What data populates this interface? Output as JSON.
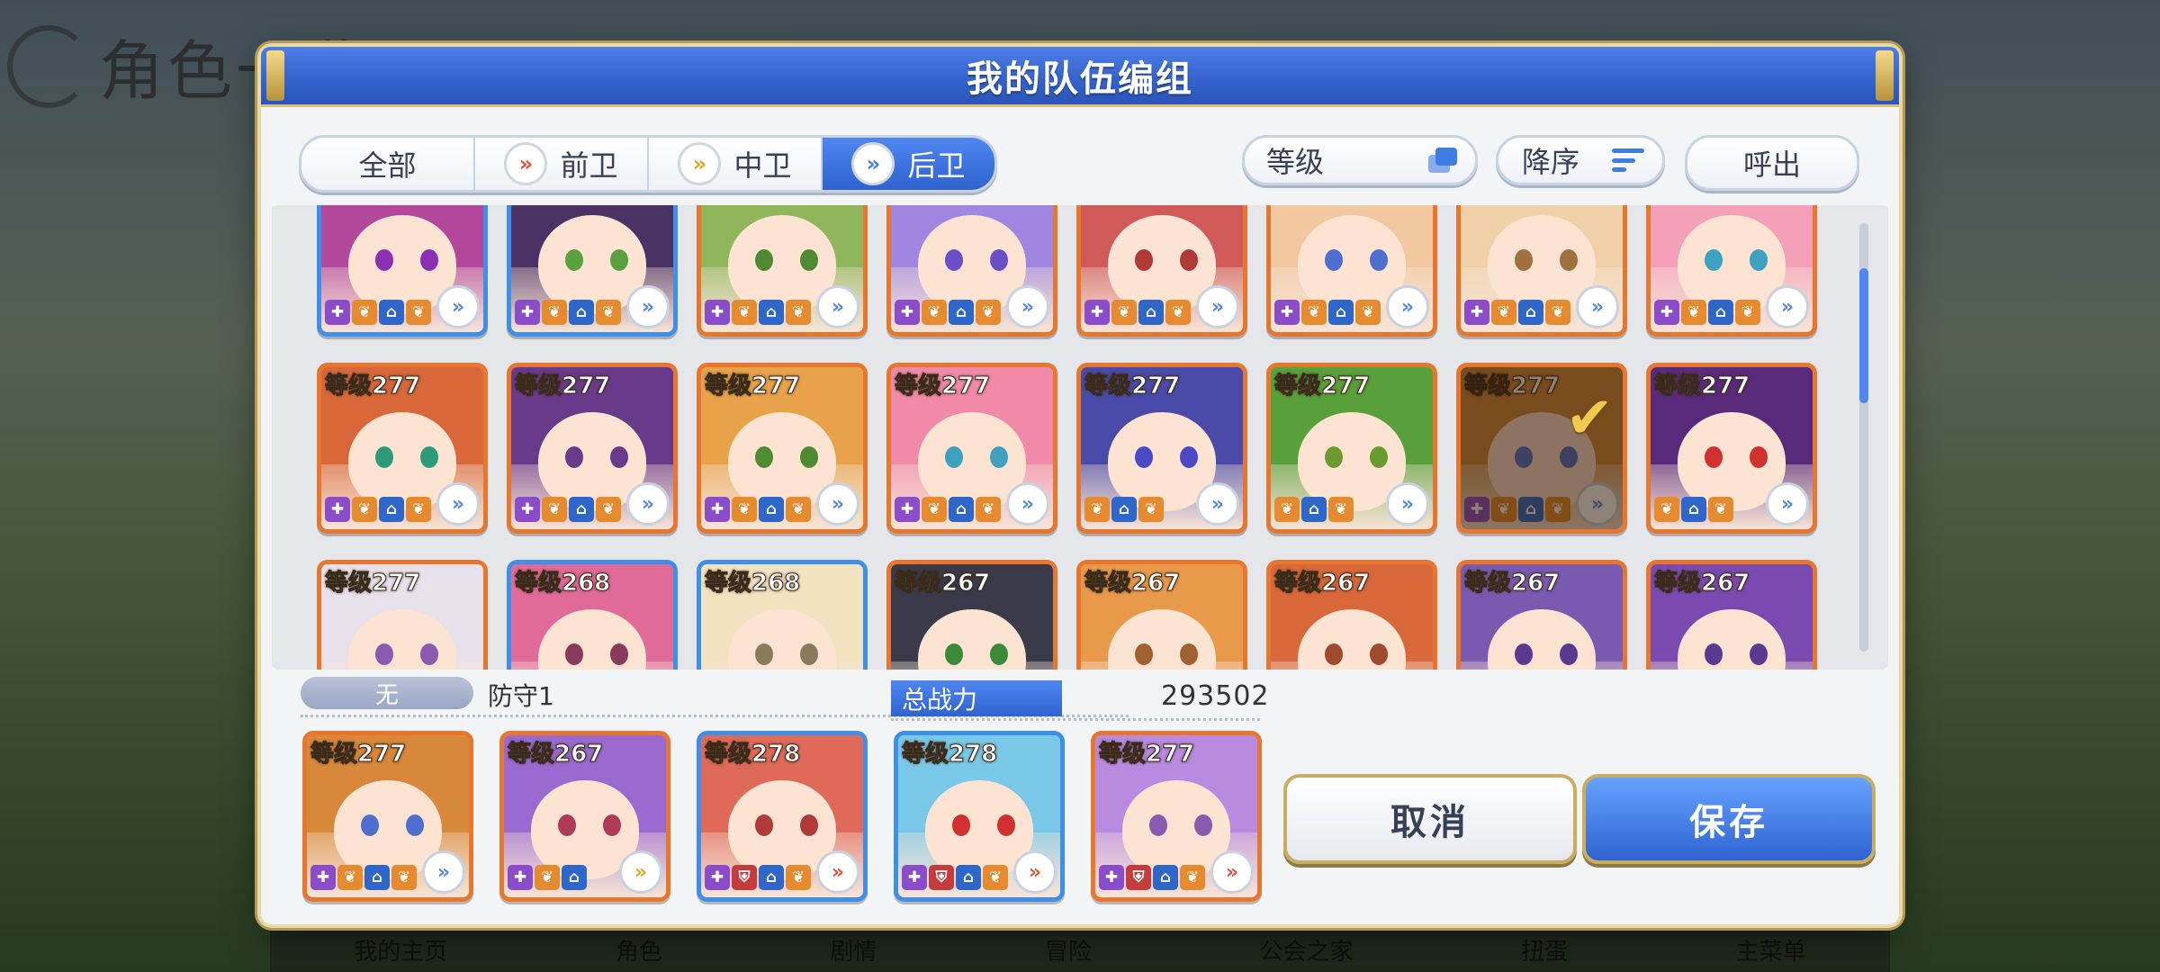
{
  "background": {
    "title": "角色一览",
    "nav": [
      "我的主页",
      "角色",
      "剧情",
      "冒险",
      "公会之家",
      "扭蛋",
      "主菜单"
    ]
  },
  "modal": {
    "title": "我的队伍编组"
  },
  "filters": {
    "tabs": [
      {
        "label": "全部",
        "icon": "",
        "icon_color": "none",
        "active": false
      },
      {
        "label": "前卫",
        "icon": "»",
        "icon_color": "red",
        "active": false
      },
      {
        "label": "中卫",
        "icon": "»",
        "icon_color": "gold",
        "active": false
      },
      {
        "label": "后卫",
        "icon": "»",
        "icon_color": "blue",
        "active": true
      }
    ],
    "sort_key": "等级",
    "sort_order": "降序",
    "call_label": "呼出"
  },
  "grid": {
    "rows": [
      {
        "cards": [
          {
            "level": "",
            "frame": "blue",
            "hair": "#b3479c",
            "eye": "#8b2fb3",
            "icons": [
              "purple",
              "orange",
              "blue",
              "orange"
            ]
          },
          {
            "level": "",
            "frame": "blue",
            "hair": "#4a3264",
            "eye": "#5aa040",
            "icons": [
              "purple",
              "orange",
              "blue",
              "orange"
            ]
          },
          {
            "level": "",
            "frame": "gold",
            "hair": "#8fb65a",
            "eye": "#4f8a32",
            "icons": [
              "purple",
              "orange",
              "blue",
              "orange"
            ]
          },
          {
            "level": "",
            "frame": "gold",
            "hair": "#9f86e0",
            "eye": "#6b4fc7",
            "icons": [
              "purple",
              "orange",
              "blue",
              "orange"
            ]
          },
          {
            "level": "",
            "frame": "gold",
            "hair": "#d05a5a",
            "eye": "#b03a3a",
            "icons": [
              "purple",
              "orange",
              "blue",
              "orange"
            ]
          },
          {
            "level": "",
            "frame": "gold",
            "hair": "#f2c8a0",
            "eye": "#4f6fd0",
            "icons": [
              "purple",
              "orange",
              "blue",
              "orange"
            ]
          },
          {
            "level": "",
            "frame": "gold",
            "hair": "#f0d0a8",
            "eye": "#a07040",
            "icons": [
              "purple",
              "orange",
              "blue",
              "orange"
            ]
          },
          {
            "level": "",
            "frame": "gold",
            "hair": "#f4a0b8",
            "eye": "#3fa0c0",
            "icons": [
              "purple",
              "orange",
              "blue",
              "orange"
            ]
          }
        ]
      },
      {
        "cards": [
          {
            "level": "等级277",
            "frame": "gold",
            "hair": "#d8683a",
            "eye": "#2f9a7a",
            "icons": [
              "purple",
              "orange",
              "blue",
              "orange"
            ]
          },
          {
            "level": "等级277",
            "frame": "gold",
            "hair": "#6a3a8a",
            "eye": "#6a3a8a",
            "icons": [
              "purple",
              "orange",
              "blue",
              "orange"
            ]
          },
          {
            "level": "等级277",
            "frame": "gold",
            "hair": "#e8a24a",
            "eye": "#4f8a32",
            "icons": [
              "purple",
              "orange",
              "blue",
              "orange"
            ]
          },
          {
            "level": "等级277",
            "frame": "gold",
            "hair": "#f08aa8",
            "eye": "#3fa0c0",
            "icons": [
              "purple",
              "orange",
              "blue",
              "orange"
            ]
          },
          {
            "level": "等级277",
            "frame": "gold",
            "hair": "#4a4aa8",
            "eye": "#4a4ac8",
            "icons": [
              "orange",
              "blue",
              "orange"
            ]
          },
          {
            "level": "等级277",
            "frame": "gold",
            "hair": "#5aa03a",
            "eye": "#6a9a30",
            "icons": [
              "orange",
              "blue",
              "orange"
            ]
          },
          {
            "level": "等级277",
            "frame": "gold",
            "hair": "#d08a3a",
            "eye": "#4f6fd0",
            "icons": [
              "purple",
              "orange",
              "blue",
              "orange"
            ],
            "selected": true
          },
          {
            "level": "等级277",
            "frame": "gold",
            "hair": "#5a2a7a",
            "eye": "#d03030",
            "icons": [
              "orange",
              "blue",
              "orange"
            ]
          }
        ]
      },
      {
        "cards": [
          {
            "level": "等级277",
            "frame": "gold",
            "hair": "#e8e0ea",
            "eye": "#8a5ab0",
            "icons": []
          },
          {
            "level": "等级268",
            "frame": "blue",
            "hair": "#e06a98",
            "eye": "#8a3a5a",
            "icons": []
          },
          {
            "level": "等级268",
            "frame": "blue",
            "hair": "#f2e2c0",
            "eye": "#8a7a5a",
            "icons": []
          },
          {
            "level": "等级267",
            "frame": "gold",
            "hair": "#3a3a4a",
            "eye": "#3a8a3a",
            "icons": []
          },
          {
            "level": "等级267",
            "frame": "gold",
            "hair": "#e89a4a",
            "eye": "#a06030",
            "icons": []
          },
          {
            "level": "等级267",
            "frame": "gold",
            "hair": "#d8683a",
            "eye": "#a04a30",
            "icons": []
          },
          {
            "level": "等级267",
            "frame": "gold",
            "hair": "#7a5ab0",
            "eye": "#5a3a90",
            "icons": []
          },
          {
            "level": "等级267",
            "frame": "gold",
            "hair": "#7a4ab0",
            "eye": "#5a3a90",
            "icons": []
          }
        ]
      }
    ]
  },
  "team": {
    "tag": "无",
    "name": "防守1",
    "power_label": "总战力",
    "power_value": "293502",
    "members": [
      {
        "level": "等级277",
        "frame": "gold",
        "hair": "#d8883a",
        "eye": "#4f6fd0",
        "icons": [
          "purple",
          "orange",
          "blue",
          "orange"
        ],
        "pos": "blue"
      },
      {
        "level": "等级267",
        "frame": "gold",
        "hair": "#9a6ad0",
        "eye": "#b03a5a",
        "icons": [
          "purple",
          "orange",
          "blue"
        ],
        "pos": "gold"
      },
      {
        "level": "等级278",
        "frame": "blue",
        "hair": "#e06a5a",
        "eye": "#b03a3a",
        "icons": [
          "purple",
          "red",
          "blue",
          "orange"
        ],
        "pos": "red"
      },
      {
        "level": "等级278",
        "frame": "blue",
        "hair": "#7ac8e8",
        "eye": "#d03030",
        "icons": [
          "purple",
          "red",
          "blue",
          "orange"
        ],
        "pos": "red"
      },
      {
        "level": "等级277",
        "frame": "gold",
        "hair": "#b88ae0",
        "eye": "#8a5ab0",
        "icons": [
          "purple",
          "red",
          "blue",
          "orange"
        ],
        "pos": "red"
      }
    ]
  },
  "buttons": {
    "cancel": "取消",
    "save": "保存"
  }
}
